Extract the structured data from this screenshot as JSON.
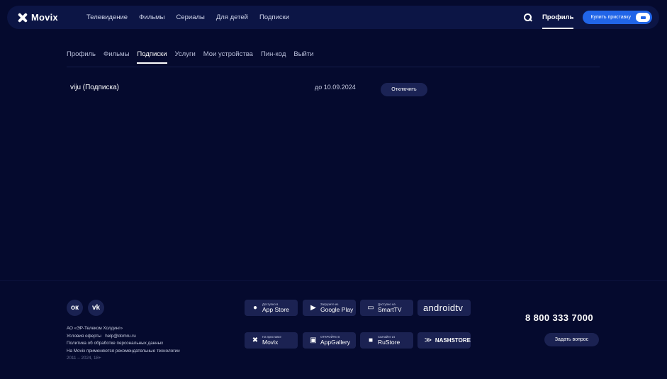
{
  "header": {
    "logo": "Movix",
    "nav": [
      "Телевидение",
      "Фильмы",
      "Сериалы",
      "Для детей",
      "Подписки"
    ],
    "profile_label": "Профиль",
    "buy_label": "Купить приставку"
  },
  "subnav": {
    "items": [
      "Профиль",
      "Фильмы",
      "Подписки",
      "Услуги",
      "Мои устройства",
      "Пин-код",
      "Выйти"
    ],
    "active": "Подписки"
  },
  "subscription": {
    "name": "viju (Подписка)",
    "until": "до 10.09.2024",
    "action_label": "Отключить"
  },
  "footer": {
    "social": [
      {
        "icon": "odnoklassniki-icon",
        "glyph": "ок"
      },
      {
        "icon": "vk-icon",
        "glyph": "vk"
      }
    ],
    "legal": [
      "АО «ЭР-Телеком Холдинг»",
      "Условия оферты",
      "help@domru.ru",
      "Политика об обработке персональных данных",
      "На Movix применяются рекомендательные технологии",
      "2011 – 2024, 18+"
    ],
    "stores": [
      {
        "icon": "apple-icon",
        "small": "Доступно в",
        "big": "App Store"
      },
      {
        "icon": "google-play-icon",
        "small": "Загрузите из",
        "big": "Google Play"
      },
      {
        "icon": "smarttv-icon",
        "small": "Доступно на",
        "big": "SmartTV"
      },
      {
        "icon": "android-tv-icon",
        "small": "",
        "big": "androidtv"
      },
      {
        "icon": "movix-icon",
        "small": "На приставке",
        "big": "Movix"
      },
      {
        "icon": "appgallery-icon",
        "small": "ОТКРОЙТЕ В",
        "big": "AppGallery"
      },
      {
        "icon": "rustore-icon",
        "small": "Скачайте из",
        "big": "RuStore"
      },
      {
        "icon": "nashstore-icon",
        "small": "",
        "big": "NASHSTORE"
      }
    ],
    "phone": "8 800 333 7000",
    "ask_label": "Задать вопрос"
  }
}
